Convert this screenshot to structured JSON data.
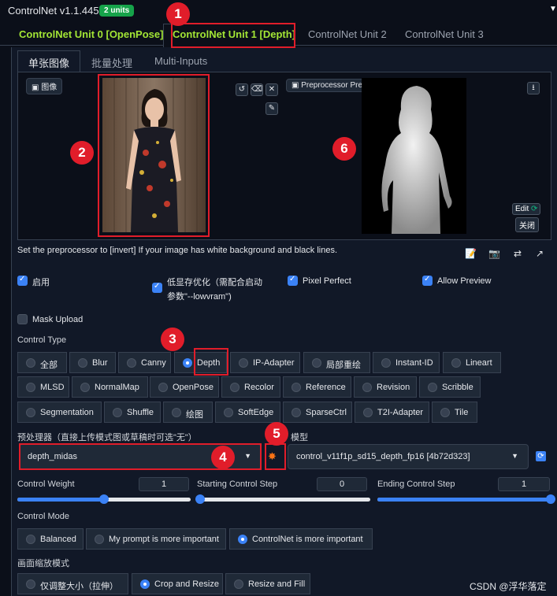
{
  "header": {
    "title": "ControlNet v1.1.445",
    "badge": "2 units",
    "collapse_glyph": "▼"
  },
  "unit_tabs": [
    {
      "label": "ControlNet Unit 0 [OpenPose]"
    },
    {
      "label": "ControlNet Unit 1 [Depth]"
    },
    {
      "label": "ControlNet Unit 2"
    },
    {
      "label": "ControlNet Unit 3"
    }
  ],
  "sub_tabs": [
    {
      "label": "单张图像"
    },
    {
      "label": "批量处理"
    },
    {
      "label": "Multi-Inputs"
    }
  ],
  "image_panel": {
    "input_label": "图像",
    "preview_label": "Preprocessor Preview",
    "edit_label": "Edit",
    "close_label": "关闭"
  },
  "hint": "Set the preprocessor to [invert] If your image has white background and black lines.",
  "checkboxes": {
    "enable": {
      "label": "启用",
      "checked": true
    },
    "lowvram": {
      "label_line1": "低显存优化（需配合启动",
      "label_line2": "参数\"--lowvram\")",
      "checked": true
    },
    "pixel_perfect": {
      "label": "Pixel Perfect",
      "checked": true
    },
    "allow_preview": {
      "label": "Allow Preview",
      "checked": true
    },
    "mask_upload": {
      "label": "Mask Upload",
      "checked": false
    }
  },
  "control_type": {
    "label": "Control Type",
    "options": [
      "全部",
      "Blur",
      "Canny",
      "Depth",
      "IP-Adapter",
      "局部重绘",
      "Instant-ID",
      "Lineart",
      "MLSD",
      "NormalMap",
      "OpenPose",
      "Recolor",
      "Reference",
      "Revision",
      "Scribble",
      "Segmentation",
      "Shuffle",
      "绘图",
      "SoftEdge",
      "SparseCtrl",
      "T2I-Adapter",
      "Tile"
    ],
    "selected": "Depth"
  },
  "preprocessor": {
    "label": "预处理器（直接上传模式图或草稿时可选\"无\"）",
    "value": "depth_midas"
  },
  "model": {
    "label": "模型",
    "value": "control_v11f1p_sd15_depth_fp16 [4b72d323]"
  },
  "sliders": {
    "weight": {
      "label": "Control Weight",
      "value": "1",
      "fraction": 0.5
    },
    "start": {
      "label": "Starting Control Step",
      "value": "0",
      "fraction": 0.0
    },
    "end": {
      "label": "Ending Control Step",
      "value": "1",
      "fraction": 1.0
    }
  },
  "control_mode": {
    "label": "Control Mode",
    "options": [
      "Balanced",
      "My prompt is more important",
      "ControlNet is more important"
    ],
    "selected": "ControlNet is more important"
  },
  "resize_mode": {
    "label": "画面缩放模式",
    "options": [
      "仅调整大小（拉伸）",
      "Crop and Resize",
      "Resize and Fill"
    ],
    "selected": "Crop and Resize"
  },
  "annotations": [
    "1",
    "2",
    "3",
    "4",
    "5",
    "6"
  ],
  "watermark": "CSDN @浮华落定",
  "colors": {
    "accent": "#3b82f6",
    "active_tab": "#a3e635",
    "annotation": "#e11d2a",
    "badge": "#16a34a"
  }
}
